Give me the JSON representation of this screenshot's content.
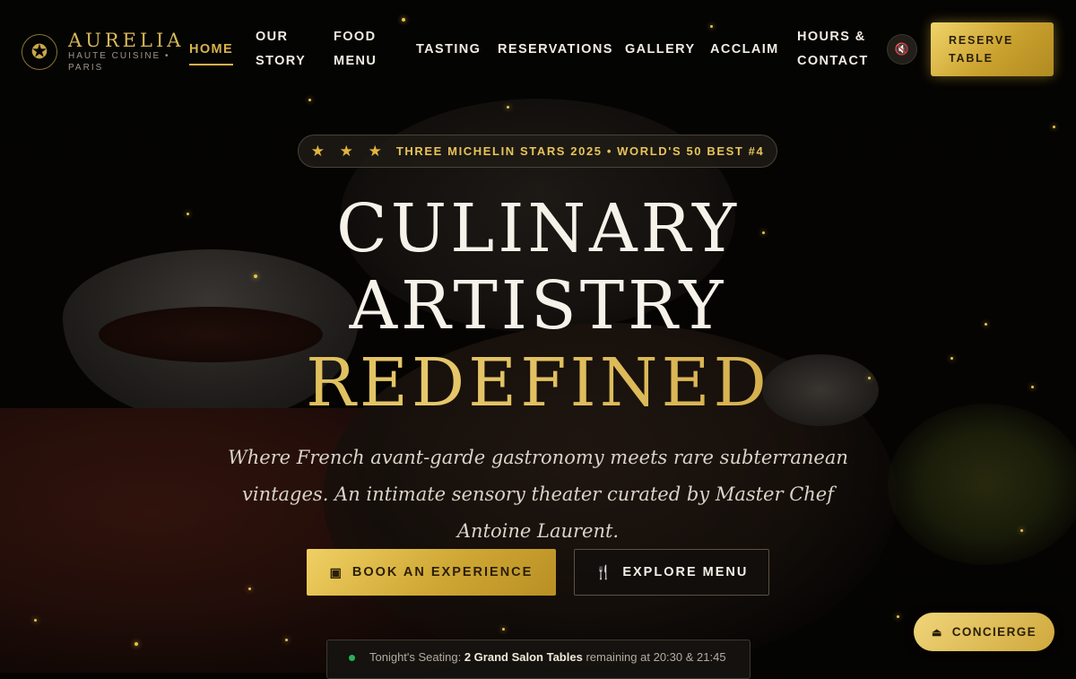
{
  "brand": {
    "name": "AURELIA",
    "subtitle": "HAUTE CUISINE • PARIS",
    "logo_icon": "star-emblem-icon"
  },
  "nav": {
    "items": [
      {
        "label": "HOME",
        "active": true
      },
      {
        "label": "OUR STORY"
      },
      {
        "label": "FOOD MENU"
      },
      {
        "label": "TASTING"
      },
      {
        "label": "RESERVATIONS"
      },
      {
        "label": "GALLERY"
      },
      {
        "label": "ACCLAIM"
      },
      {
        "label": "HOURS & CONTACT"
      }
    ],
    "mute_icon": "speaker-muted-icon",
    "reserve_label": "RESERVE TABLE"
  },
  "hero": {
    "badge": {
      "stars": "★ ★ ★",
      "text": "THREE MICHELIN STARS 2025 • WORLD'S 50 BEST #4"
    },
    "title_line1": "CULINARY",
    "title_line2": "ARTISTRY",
    "title_line3": "REDEFINED",
    "lead": "Where French avant-garde gastronomy meets rare subterranean vintages. An intimate sensory theater curated by Master Chef Antoine Laurent.",
    "primary_cta": {
      "label": "BOOK AN EXPERIENCE",
      "icon": "calendar-check-icon"
    },
    "secondary_cta": {
      "label": "EXPLORE MENU",
      "icon": "fork-knife-icon"
    }
  },
  "seating": {
    "prefix": "Tonight's Seating:",
    "highlight": "2 Grand Salon Tables",
    "suffix": "remaining at 20:30 & 21:45",
    "status_color": "#25b35a"
  },
  "concierge": {
    "label": "CONCIERGE",
    "icon": "service-bell-icon"
  },
  "colors": {
    "gold": "#d8b24c",
    "background": "#050403",
    "text": "#f1ece2"
  }
}
